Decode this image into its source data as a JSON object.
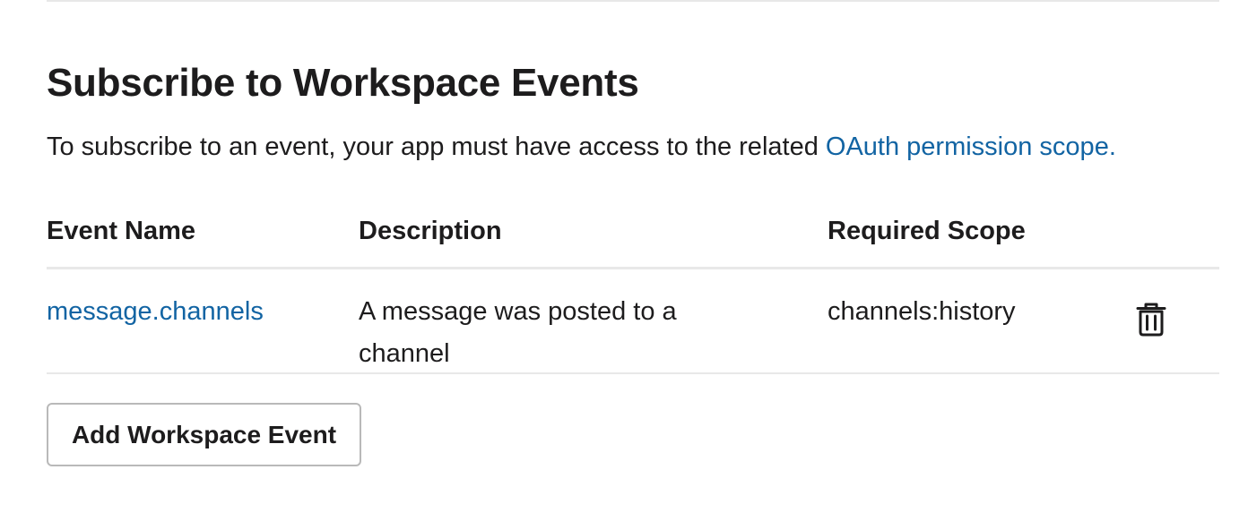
{
  "section": {
    "title": "Subscribe to Workspace Events",
    "intro_text": "To subscribe to an event, your app must have access to the related ",
    "intro_link": "OAuth permission scope."
  },
  "table": {
    "headers": {
      "event_name": "Event Name",
      "description": "Description",
      "required_scope": "Required Scope"
    },
    "rows": [
      {
        "event_name": "message.channels",
        "description": "A message was posted to a channel",
        "required_scope": "channels:history",
        "action_icon": "trash-icon"
      }
    ]
  },
  "actions": {
    "add_label": "Add Workspace Event"
  },
  "colors": {
    "link": "#1264a3",
    "text": "#1d1c1d",
    "divider": "#e8e8e8"
  }
}
